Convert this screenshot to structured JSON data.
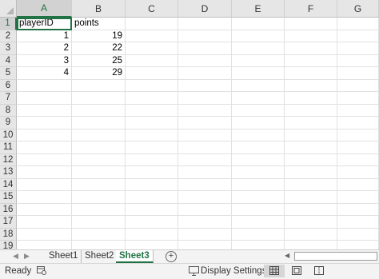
{
  "columns": [
    "A",
    "B",
    "C",
    "D",
    "E",
    "F",
    "G"
  ],
  "rows": [
    "1",
    "2",
    "3",
    "4",
    "5",
    "6",
    "7",
    "8",
    "9",
    "10",
    "11",
    "12",
    "13",
    "14",
    "15",
    "16",
    "17",
    "18",
    "19"
  ],
  "cells": [
    [
      {
        "v": "playerID",
        "t": "s"
      },
      {
        "v": "points",
        "t": "s"
      }
    ],
    [
      {
        "v": "1",
        "t": "n"
      },
      {
        "v": "19",
        "t": "n"
      }
    ],
    [
      {
        "v": "2",
        "t": "n"
      },
      {
        "v": "22",
        "t": "n"
      }
    ],
    [
      {
        "v": "3",
        "t": "n"
      },
      {
        "v": "25",
        "t": "n"
      }
    ],
    [
      {
        "v": "4",
        "t": "n"
      },
      {
        "v": "29",
        "t": "n"
      }
    ]
  ],
  "active_cell": "A1",
  "sheets": [
    {
      "label": "Sheet1",
      "active": false
    },
    {
      "label": "Sheet2",
      "active": false
    },
    {
      "label": "Sheet3",
      "active": true
    }
  ],
  "add_sheet_icon": "plus-circle-icon",
  "status": {
    "ready": "Ready",
    "macro_icon": "macro-recording-icon",
    "display_settings": "Display Settings",
    "display_icon": "display-settings-icon",
    "views": [
      "normal-view-icon",
      "page-layout-view-icon",
      "page-break-preview-icon"
    ],
    "active_view": "normal-view-icon"
  },
  "colors": {
    "accent": "#217346",
    "header_bg": "#e6e6e6",
    "gridline": "#e1e1e1"
  }
}
